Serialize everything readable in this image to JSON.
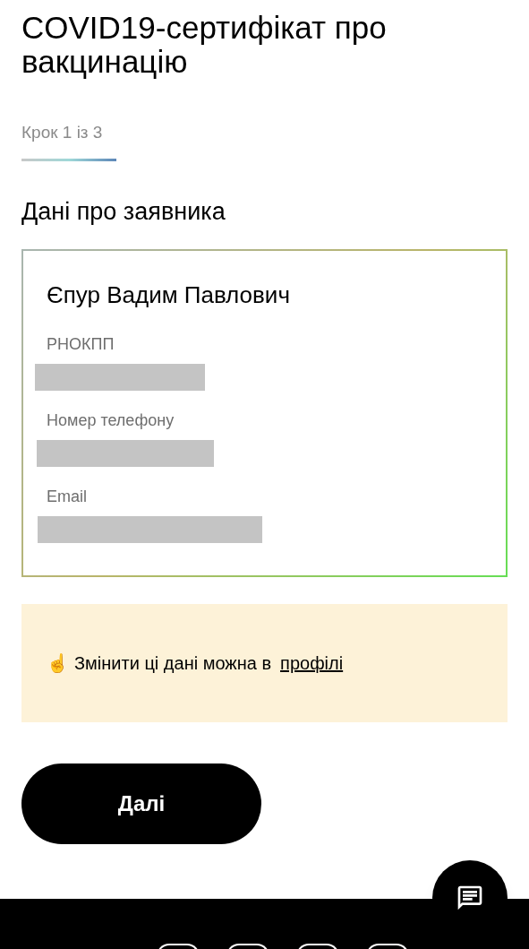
{
  "title": "COVID19-сертифікат про вакцинацію",
  "step": {
    "label": "Крок 1 із 3"
  },
  "section_title": "Дані про заявника",
  "applicant": {
    "name": "Єпур Вадим Павлович",
    "fields": [
      {
        "label": "РНОКПП",
        "redacted": true
      },
      {
        "label": "Номер телефону",
        "redacted": true
      },
      {
        "label": "Email",
        "redacted": true
      }
    ]
  },
  "notice": {
    "emoji": "☝",
    "text": "Змінити ці дані можна в",
    "link": "профілі"
  },
  "next_button": "Далі"
}
